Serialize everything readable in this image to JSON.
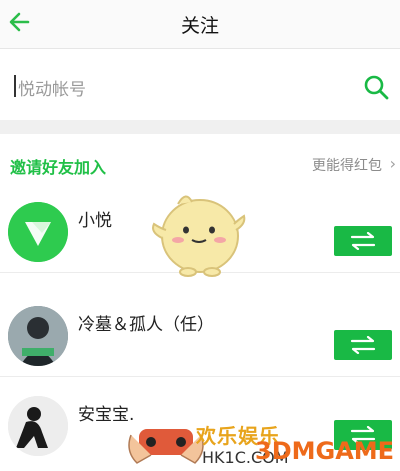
{
  "header": {
    "title": "关注"
  },
  "search": {
    "placeholder": "悦动帐号"
  },
  "invite": {
    "title": "邀请好友加入",
    "subtitle": "更能得红包"
  },
  "friends": [
    {
      "name": "小悦"
    },
    {
      "name": "冷墓＆孤人（任）"
    },
    {
      "name": "安宝宝."
    }
  ],
  "watermark": {
    "cn": "欢乐娱乐",
    "site": "HK1C.COM",
    "brand": "3DMGAME"
  },
  "colors": {
    "accent": "#20c047",
    "button": "#19b945",
    "band": "#f0f0f0"
  },
  "icons": {
    "back": "arrow-left-icon",
    "search": "search-icon",
    "follow": "swap-arrows-icon",
    "invite_more": "chevron-right-icon"
  }
}
